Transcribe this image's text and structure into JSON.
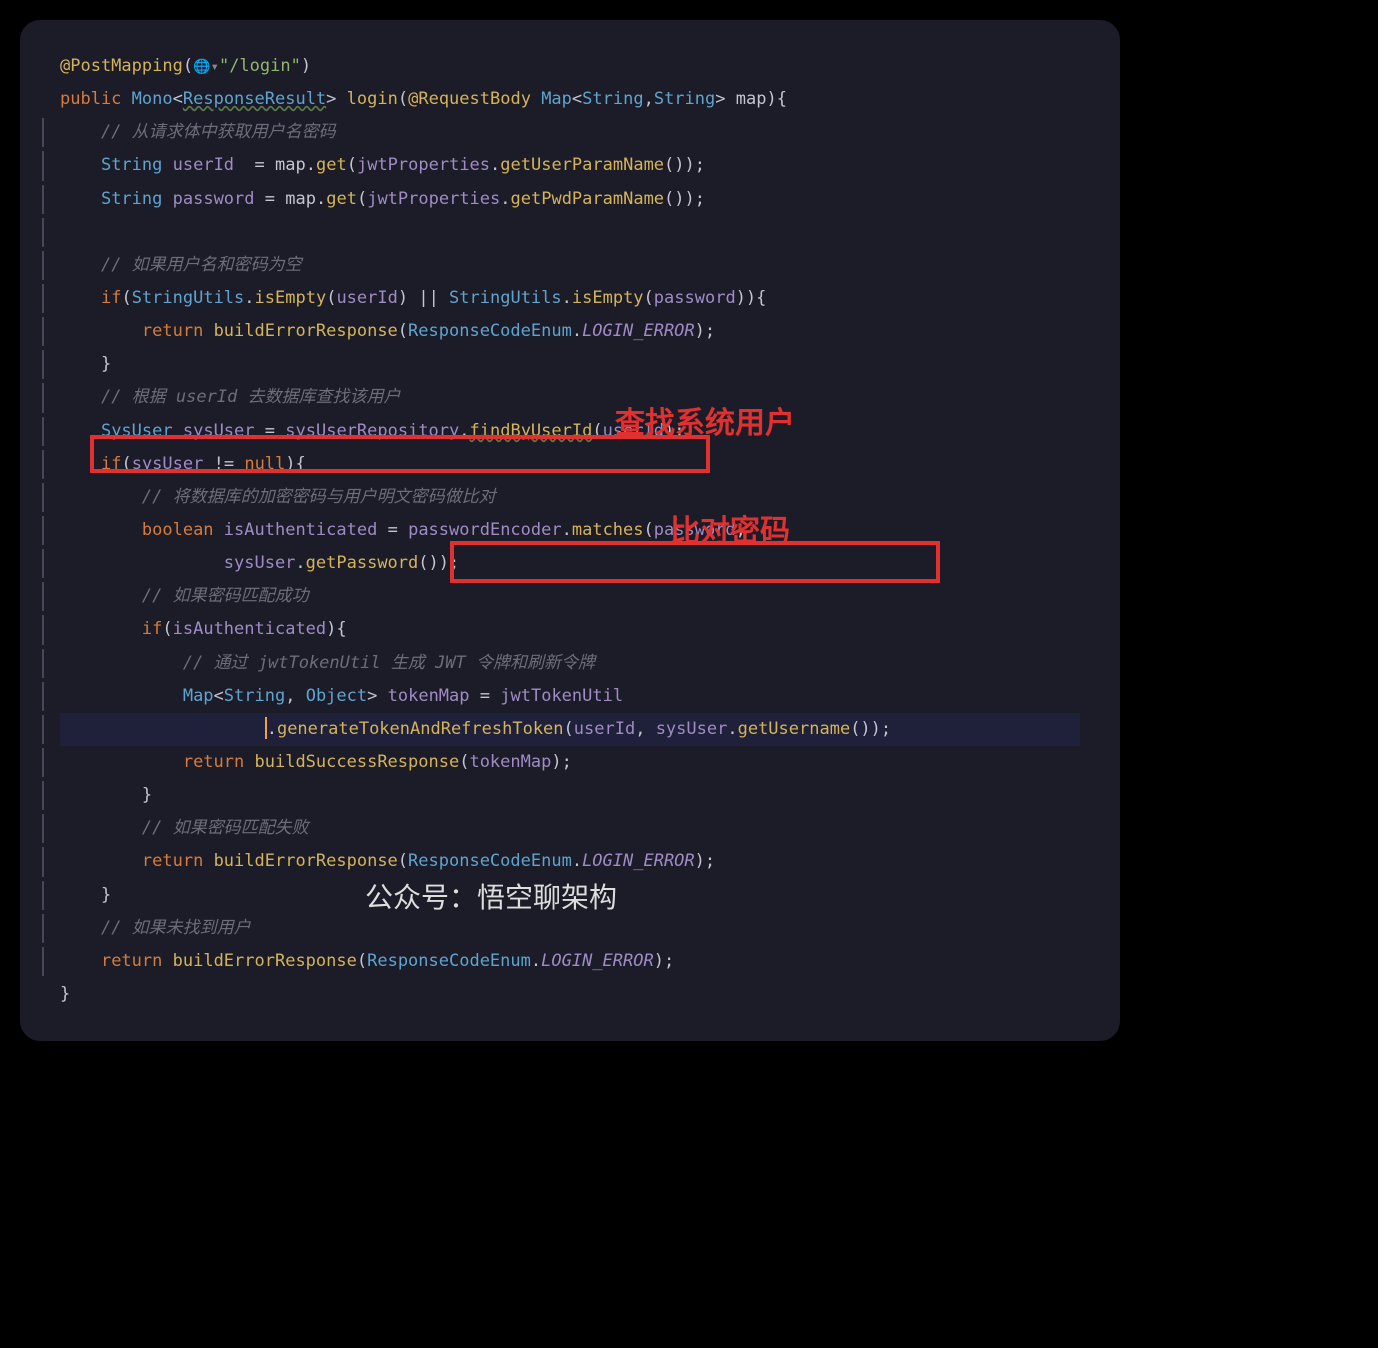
{
  "annotations": {
    "red_label_1": "查找系统用户",
    "red_label_2": "比对密码",
    "watermark": "公众号：悟空聊架构"
  },
  "code": {
    "l1_annotation": "@PostMapping",
    "l1_string": "\"/login\"",
    "l2_public": "public",
    "l2_mono": "Mono",
    "l2_rr": "ResponseResult",
    "l2_login": "login",
    "l2_reqbody": "@RequestBody",
    "l2_map": "Map",
    "l2_string": "String",
    "l2_param": "map",
    "l3_comment": "// 从请求体中获取用户名密码",
    "l4_string": "String",
    "l4_userId": "userId",
    "l4_map": "map",
    "l4_get": "get",
    "l4_jwtProps": "jwtProperties",
    "l4_getUserParam": "getUserParamName",
    "l5_string": "String",
    "l5_password": "password",
    "l5_map": "map",
    "l5_get": "get",
    "l5_jwtProps": "jwtProperties",
    "l5_getPwd": "getPwdParamName",
    "l7_comment": "// 如果用户名和密码为空",
    "l8_if": "if",
    "l8_su1": "StringUtils",
    "l8_isEmpty": "isEmpty",
    "l8_userId": "userId",
    "l8_su2": "StringUtils",
    "l8_password": "password",
    "l9_return": "return",
    "l9_buildErr": "buildErrorResponse",
    "l9_enum": "ResponseCodeEnum",
    "l9_loginErr": "LOGIN_ERROR",
    "l11_comment": "// 根据 userId 去数据库查找该用户",
    "l12_sysUser": "SysUser",
    "l12_var": "sysUser",
    "l12_repo": "sysUserRepository",
    "l12_find": "findByUserId",
    "l12_userId": "userId",
    "l13_if": "if",
    "l13_sysUser": "sysUser",
    "l13_null": "null",
    "l14_comment": "// 将数据库的加密密码与用户明文密码做比对",
    "l15_boolean": "boolean",
    "l15_isAuth": "isAuthenticated",
    "l15_encoder": "passwordEncoder",
    "l15_matches": "matches",
    "l15_password": "password",
    "l16_sysUser": "sysUser",
    "l16_getPwd": "getPassword",
    "l17_comment": "// 如果密码匹配成功",
    "l18_if": "if",
    "l18_isAuth": "isAuthenticated",
    "l19_comment": "// 通过 jwtTokenUtil 生成 JWT 令牌和刷新令牌",
    "l20_map": "Map",
    "l20_string": "String",
    "l20_object": "Object",
    "l20_tokenMap": "tokenMap",
    "l20_jwtUtil": "jwtTokenUtil",
    "l21_gen": "generateTokenAndRefreshToken",
    "l21_userId": "userId",
    "l21_sysUser": "sysUser",
    "l21_getUsername": "getUsername",
    "l22_return": "return",
    "l22_buildSuc": "buildSuccessResponse",
    "l22_tokenMap": "tokenMap",
    "l24_comment": "// 如果密码匹配失败",
    "l25_return": "return",
    "l25_buildErr": "buildErrorResponse",
    "l25_enum": "ResponseCodeEnum",
    "l25_loginErr": "LOGIN_ERROR",
    "l27_comment": "// 如果未找到用户",
    "l28_return": "return",
    "l28_buildErr": "buildErrorResponse",
    "l28_enum": "ResponseCodeEnum",
    "l28_loginErr": "LOGIN_ERROR"
  }
}
